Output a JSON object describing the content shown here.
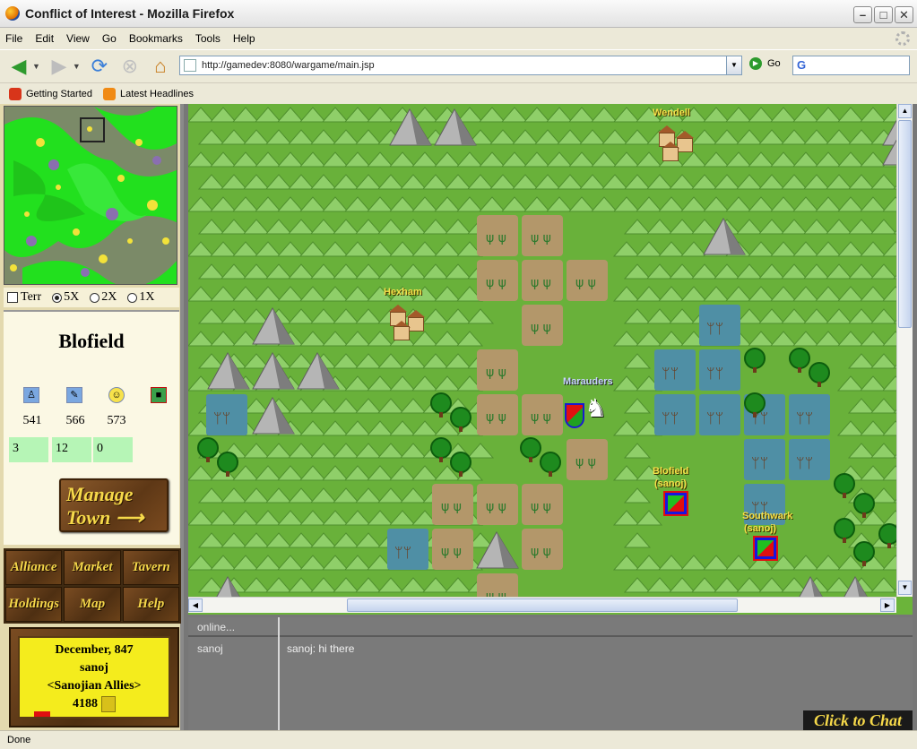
{
  "window": {
    "title": "Conflict of Interest - Mozilla Firefox"
  },
  "menubar": [
    "File",
    "Edit",
    "View",
    "Go",
    "Bookmarks",
    "Tools",
    "Help"
  ],
  "navbar": {
    "url": "http://gamedev:8080/wargame/main.jsp",
    "go_label": "Go",
    "search_placeholder": ""
  },
  "bookmarks": [
    {
      "label": "Getting Started",
      "icon": "firefox-icon"
    },
    {
      "label": "Latest Headlines",
      "icon": "rss-icon"
    }
  ],
  "minimap": {
    "options": {
      "terr": "Terr",
      "s5x": "5X",
      "s2x": "2X",
      "s1x": "1X"
    },
    "selected": "5X"
  },
  "town": {
    "name": "Blofield",
    "resources": [
      {
        "icon": "population-icon",
        "value": "541"
      },
      {
        "icon": "food-icon",
        "value": "566"
      },
      {
        "icon": "happiness-icon",
        "value": "573"
      },
      {
        "icon": "defense-icon"
      }
    ],
    "counts": [
      "3",
      "12",
      "0"
    ],
    "manage_label_1": "Manage",
    "manage_label_2": "Town"
  },
  "menu": [
    "Alliance",
    "Market",
    "Tavern",
    "Holdings",
    "Map",
    "Help"
  ],
  "status_box": {
    "date": "December, 847",
    "player": "sanoj",
    "alliance": "<Sanojian Allies>",
    "gold": "4188"
  },
  "map": {
    "towns": [
      {
        "name": "Wendell"
      },
      {
        "name": "Hexham"
      },
      {
        "name": "Blofield",
        "owner": "(sanoj)"
      },
      {
        "name": "Southwark",
        "owner": "(sanoj)"
      }
    ],
    "army": {
      "name": "Marauders"
    }
  },
  "chat": {
    "header": "online...",
    "users": [
      "sanoj"
    ],
    "messages": [
      "sanoj: hi there"
    ],
    "button": "Click to Chat"
  },
  "statusbar": {
    "text": "Done"
  },
  "colors": {
    "grass": "#69b13a",
    "panel": "#fbf8e4",
    "gold_text": "#f6d94a",
    "wood": "#5e3816"
  }
}
